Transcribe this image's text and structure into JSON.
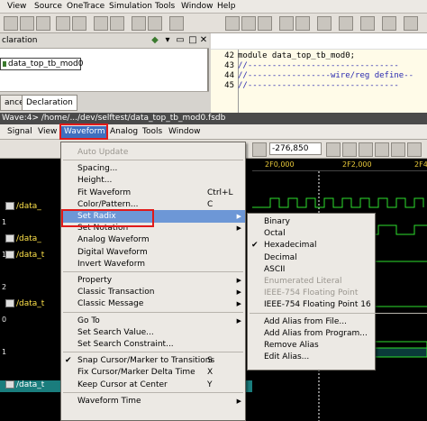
{
  "top_menubar": {
    "items": [
      "View",
      "Source",
      "OneTrace",
      "Simulation",
      "Tools",
      "Window",
      "Help"
    ]
  },
  "declaration_pane": {
    "header": "claration",
    "item": "data_top_tb_mod0",
    "tabs": [
      "ance",
      "Declaration"
    ]
  },
  "code_pane": {
    "lines": [
      {
        "num": "42",
        "text": "module data_top_tb_mod0;"
      },
      {
        "num": "43",
        "text": "//-------------------------------"
      },
      {
        "num": "44",
        "text": "//-----------------wire/reg define--"
      },
      {
        "num": "45",
        "text": "//-------------------------------"
      }
    ]
  },
  "wave_window": {
    "title": "Wave:4> /home/.../dev/selftest/data_top_tb_mod0.fsdb",
    "menubar": [
      "Signal",
      "View",
      "Waveform",
      "Analog",
      "Tools",
      "Window"
    ],
    "cursor_value": "-276,850",
    "timeline": [
      "2F0,000",
      "2F2,000",
      "2F4"
    ]
  },
  "signals": [
    {
      "num": "",
      "name": "",
      "sel": false
    },
    {
      "num": "",
      "name": "",
      "sel": false
    },
    {
      "num": "",
      "name": "/data_",
      "sel": false
    },
    {
      "num": "1",
      "name": "",
      "sel": false
    },
    {
      "num": "",
      "name": "/data_",
      "sel": false
    },
    {
      "num": "1",
      "name": "/data_t",
      "sel": false
    },
    {
      "num": "",
      "name": "",
      "sel": false
    },
    {
      "num": "2",
      "name": "",
      "sel": false
    },
    {
      "num": "",
      "name": "/data_t",
      "sel": false
    },
    {
      "num": "0",
      "name": "",
      "sel": false
    },
    {
      "num": "",
      "name": "",
      "sel": false
    },
    {
      "num": "1",
      "name": "",
      "sel": false
    },
    {
      "num": "",
      "name": "",
      "sel": false
    },
    {
      "num": "",
      "name": "/data_t",
      "sel": true
    },
    {
      "num": "",
      "name": "",
      "sel": false
    }
  ],
  "waveform_menu": {
    "items": [
      {
        "label": "Auto Update",
        "disabled": true
      },
      {
        "sep": true
      },
      {
        "label": "Spacing..."
      },
      {
        "label": "Height..."
      },
      {
        "label": "Fit Waveform",
        "shortcut": "Ctrl+L"
      },
      {
        "label": "Color/Pattern...",
        "shortcut": "C"
      },
      {
        "label": "Set Radix",
        "submenu": true,
        "highlighted": true
      },
      {
        "label": "Set Notation",
        "submenu": true
      },
      {
        "label": "Analog Waveform"
      },
      {
        "label": "Digital Waveform"
      },
      {
        "label": "Invert Waveform"
      },
      {
        "sep": true
      },
      {
        "label": "Property",
        "submenu": true
      },
      {
        "label": "Classic Transaction",
        "submenu": true
      },
      {
        "label": "Classic Message",
        "submenu": true
      },
      {
        "sep": true
      },
      {
        "label": "Go To",
        "submenu": true
      },
      {
        "label": "Set Search Value..."
      },
      {
        "label": "Set Search Constraint..."
      },
      {
        "sep": true
      },
      {
        "label": "Snap Cursor/Marker to Transitions",
        "shortcut": "S",
        "checked": true
      },
      {
        "label": "Fix Cursor/Marker Delta Time",
        "shortcut": "X"
      },
      {
        "label": "Keep Cursor at Center",
        "shortcut": "Y"
      },
      {
        "sep": true
      },
      {
        "label": "Waveform Time",
        "submenu": true
      }
    ]
  },
  "radix_menu": {
    "items": [
      {
        "label": "Binary"
      },
      {
        "label": "Octal"
      },
      {
        "label": "Hexadecimal",
        "checked": true
      },
      {
        "label": "Decimal"
      },
      {
        "label": "ASCII"
      },
      {
        "label": "Enumerated Literal",
        "disabled": true
      },
      {
        "label": "IEEE-754 Floating Point",
        "disabled": true
      },
      {
        "label": "IEEE-754 Floating Point 16"
      },
      {
        "sep": true
      },
      {
        "label": "Add Alias from File..."
      },
      {
        "label": "Add Alias from Program..."
      },
      {
        "label": "Remove Alias"
      },
      {
        "label": "Edit Alias..."
      }
    ]
  }
}
